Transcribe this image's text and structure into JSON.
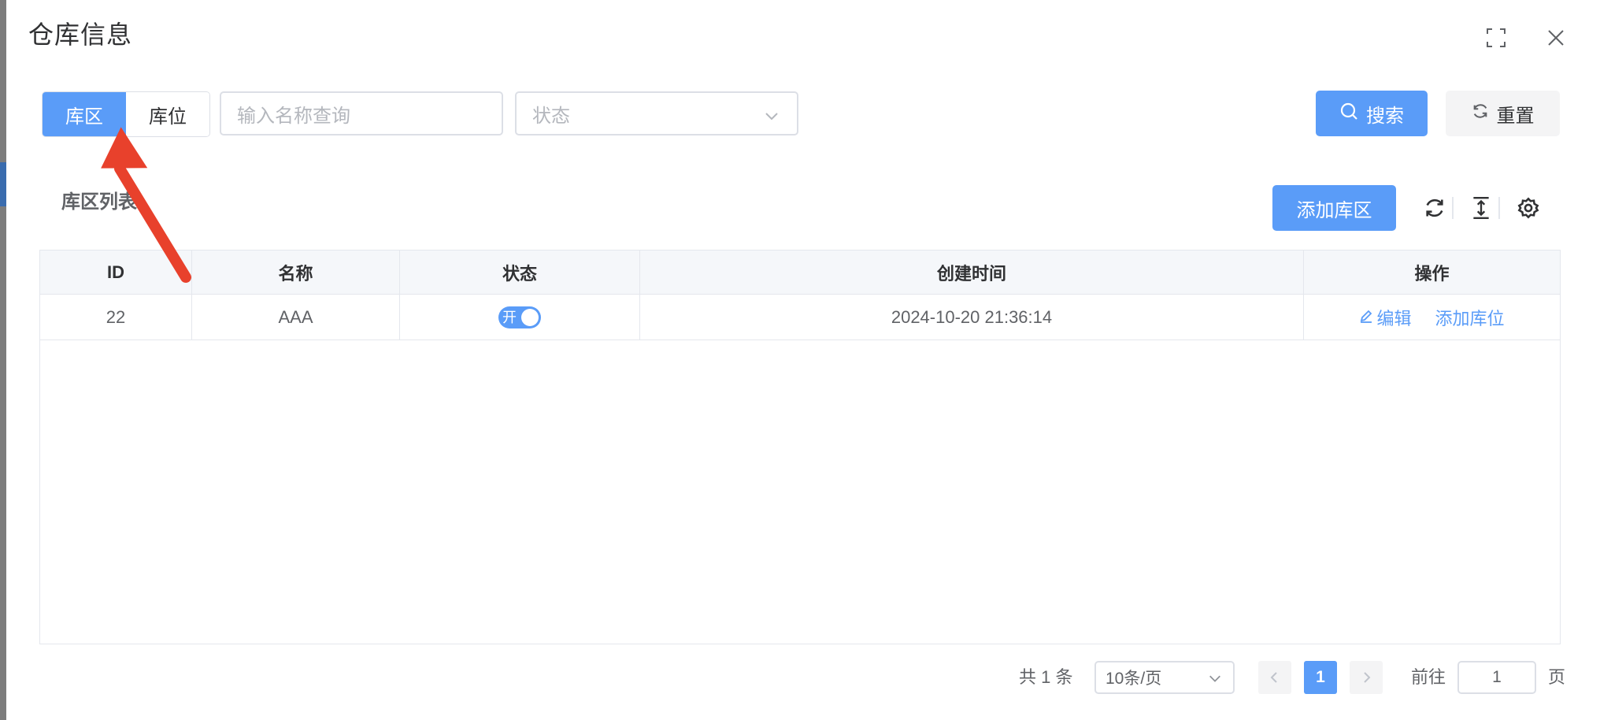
{
  "dialog": {
    "title": "仓库信息"
  },
  "filter": {
    "tabs": [
      {
        "label": "库区",
        "active": true
      },
      {
        "label": "库位",
        "active": false
      }
    ],
    "name_placeholder": "输入名称查询",
    "status_placeholder": "状态",
    "search_label": "搜索",
    "reset_label": "重置"
  },
  "toolbar": {
    "list_title": "库区列表",
    "add_label": "添加库区",
    "icons": [
      "refresh-icon",
      "column-height-icon",
      "settings-icon"
    ]
  },
  "table": {
    "columns": [
      "ID",
      "名称",
      "状态",
      "创建时间",
      "操作"
    ],
    "rows": [
      {
        "id": "22",
        "name": "AAA",
        "status_text": "开",
        "status_on": true,
        "created": "2024-10-20 21:36:14",
        "actions": [
          "编辑",
          "添加库位"
        ]
      }
    ]
  },
  "pagination": {
    "total_text": "共 1 条",
    "page_size": "10条/页",
    "current_page": "1",
    "goto_label": "前往",
    "goto_value": "1",
    "page_unit": "页"
  },
  "colors": {
    "primary": "#5a9cf8",
    "annotation_arrow": "#e8412c"
  }
}
